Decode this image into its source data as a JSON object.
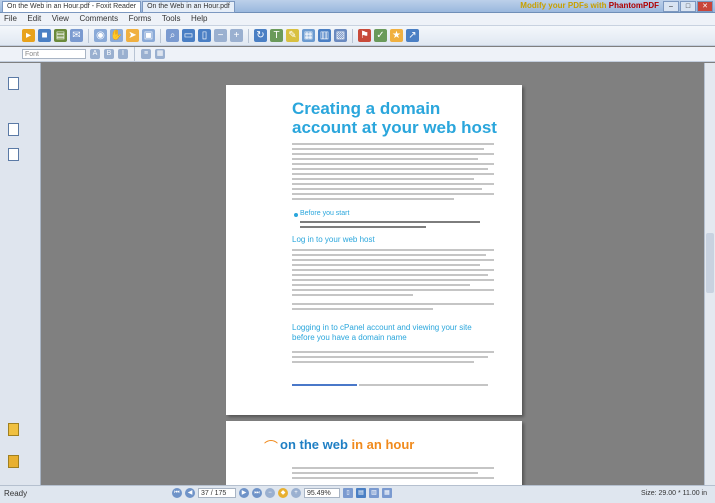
{
  "window": {
    "tabs": [
      {
        "label": "On the Web in an Hour.pdf - Foxit Reader"
      },
      {
        "label": "On the Web in an Hour.pdf"
      }
    ],
    "promo_text": "Modify your PDFs with",
    "promo_brand": "PhantomPDF",
    "controls": [
      "–",
      "□",
      "✕"
    ]
  },
  "menu": {
    "items": [
      "File",
      "Edit",
      "View",
      "Comments",
      "Forms",
      "Tools",
      "Help"
    ]
  },
  "toolbar": {
    "font_placeholder": "Font",
    "icons": [
      "open-icon",
      "save-icon",
      "print-icon",
      "email-icon",
      "scan-icon",
      "hand-tool-icon",
      "select-icon",
      "snapshot-icon",
      "zoom-icon",
      "fit-page-icon",
      "fit-width-icon",
      "zoom-out-icon",
      "zoom-in-icon",
      "rotate-icon",
      "typewriter-icon",
      "note-icon",
      "highlight-icon",
      "stamp-icon",
      "attach-icon",
      "bookmark-icon"
    ]
  },
  "page1": {
    "heading": "Creating a domain account at your web host",
    "bullet": "Before you start",
    "subheading": "Log in to your web host",
    "subheading2": "Logging in to cPanel account and viewing your site before you have a domain name"
  },
  "page2": {
    "logo_left": "on the web",
    "logo_right": "in an hour"
  },
  "status": {
    "ready": "Ready",
    "page_value": "37 / 175",
    "zoom_value": "95.49%",
    "size": "Size: 29.00 * 11.00 in"
  },
  "colors": {
    "accent": "#2aa6dc",
    "logo_blue": "#1f7fc4",
    "logo_orange": "#f08a1c"
  }
}
